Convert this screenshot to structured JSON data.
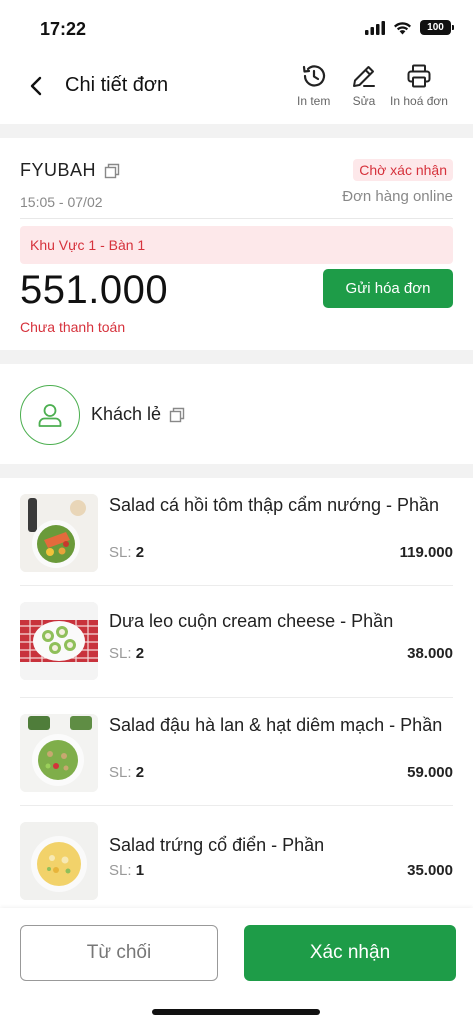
{
  "status_bar": {
    "time": "17:22",
    "battery": "100"
  },
  "header": {
    "title": "Chi tiết đơn",
    "actions": [
      {
        "label": "In tem",
        "icon": "history-icon"
      },
      {
        "label": "Sửa",
        "icon": "edit-icon"
      },
      {
        "label": "In hoá đơn",
        "icon": "printer-icon"
      }
    ]
  },
  "order": {
    "code": "FYUBAH",
    "status": "Chờ xác nhận",
    "time": "15:05 - 07/02",
    "type": "Đơn hàng online",
    "table": "Khu Vực 1 - Bàn 1",
    "total": "551.000",
    "send_invoice_label": "Gửi hóa đơn",
    "payment_status": "Chưa thanh toán"
  },
  "customer": {
    "name": "Khách lẻ"
  },
  "items": [
    {
      "name": "Salad cá hồi tôm thập cẩm nướng - Phần",
      "qty_label": "SL:",
      "qty": "2",
      "price": "119.000"
    },
    {
      "name": "Dưa leo cuộn cream cheese - Phần",
      "qty_label": "SL:",
      "qty": "2",
      "price": "38.000"
    },
    {
      "name": "Salad đậu hà lan & hạt diêm mạch - Phần",
      "qty_label": "SL:",
      "qty": "2",
      "price": "59.000"
    },
    {
      "name": "Salad trứng cổ điển - Phần",
      "qty_label": "SL:",
      "qty": "1",
      "price": "35.000"
    }
  ],
  "footer": {
    "reject_label": "Từ chối",
    "confirm_label": "Xác nhận"
  },
  "colors": {
    "accent_green": "#1e9c48",
    "alert_red": "#d6323c",
    "alert_bg": "#fde8ea"
  }
}
